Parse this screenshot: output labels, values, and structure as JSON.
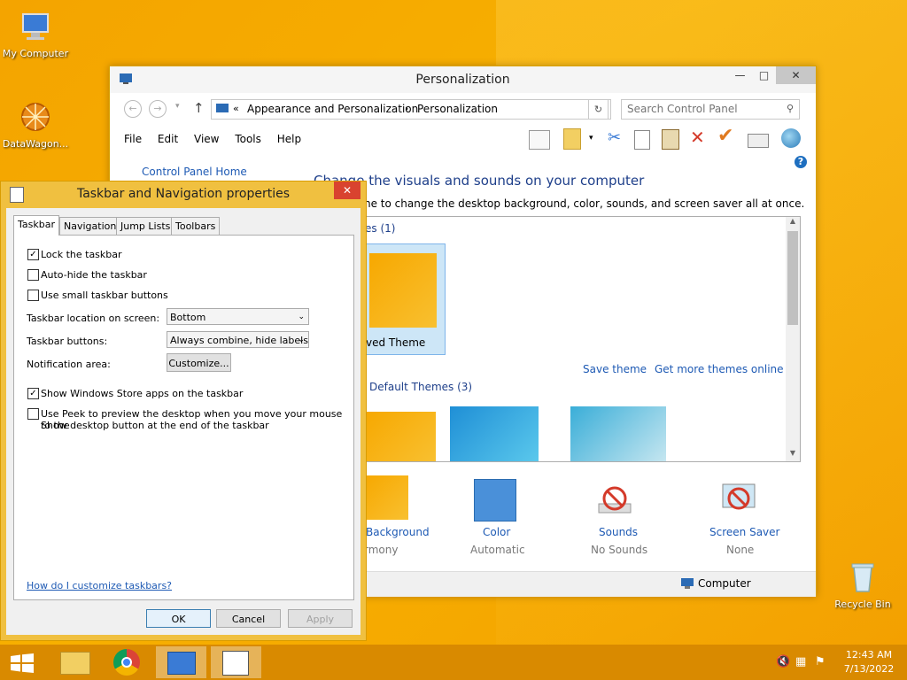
{
  "desktop": {
    "icons": [
      {
        "label": "My Computer",
        "icon": "computer-icon"
      },
      {
        "label": "DataWagon...",
        "icon": "datawagon-shortcut-icon"
      },
      {
        "label": "Recycle Bin",
        "icon": "recycle-bin-icon"
      }
    ]
  },
  "personalization": {
    "title": "Personalization",
    "window_buttons": {
      "minimize": "—",
      "maximize": "□",
      "close": "✕"
    },
    "address": {
      "chevron": "«",
      "crumb1": "Appearance and Personalization",
      "separator": "›",
      "crumb2": "Personalization"
    },
    "search_placeholder": "Search Control Panel",
    "menu": [
      "File",
      "Edit",
      "View",
      "Tools",
      "Help"
    ],
    "sidebar_link": "Control Panel Home",
    "heading": "Change the visuals and sounds on your computer",
    "subheading": "ne to change the desktop background, color, sounds, and screen saver all at once.",
    "my_themes_label": "es (1)",
    "saved_theme_label": "ved Theme",
    "save_theme": "Save theme",
    "get_more_themes": "Get more themes online",
    "default_themes_label": "Default Themes (3)",
    "bottom_items": [
      {
        "title": "Background",
        "sub": "rmony"
      },
      {
        "title": "Color",
        "sub": "Automatic"
      },
      {
        "title": "Sounds",
        "sub": "No Sounds"
      },
      {
        "title": "Screen Saver",
        "sub": "None"
      }
    ],
    "status": "Computer"
  },
  "dialog": {
    "title": "Taskbar and Navigation properties",
    "close": "✕",
    "tabs": [
      "Taskbar",
      "Navigation",
      "Jump Lists",
      "Toolbars"
    ],
    "options": {
      "lock": {
        "label": "Lock the taskbar",
        "checked": true
      },
      "autohide": {
        "label": "Auto-hide the taskbar",
        "checked": false
      },
      "small": {
        "label": "Use small taskbar buttons",
        "checked": false
      },
      "store": {
        "label": "Show Windows Store apps on the taskbar",
        "checked": true
      },
      "peek1": "Use Peek to preview the desktop when you move your mouse to the",
      "peek2": "Show desktop button at the end of the taskbar"
    },
    "location_label": "Taskbar location on screen:",
    "location_value": "Bottom",
    "buttons_label": "Taskbar buttons:",
    "buttons_value": "Always combine, hide labels",
    "notif_label": "Notification area:",
    "customize": "Customize...",
    "help_link": "How do I customize taskbars?",
    "ok": "OK",
    "cancel": "Cancel",
    "apply": "Apply"
  },
  "taskbar": {
    "time": "12:43 AM",
    "date": "7/13/2022"
  },
  "colors": {
    "accent": "#f5a800",
    "link": "#1e5ab4",
    "taskbar": "#d98a00"
  }
}
